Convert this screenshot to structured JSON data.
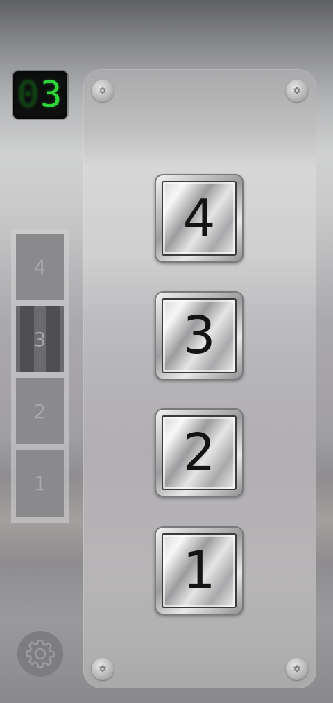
{
  "display": {
    "ghost_digit": "0",
    "current_floor_digit": "3"
  },
  "shaft": {
    "floors": [
      {
        "label": "4"
      },
      {
        "label": "3"
      },
      {
        "label": "2"
      },
      {
        "label": "1"
      }
    ],
    "current_floor": 3
  },
  "panel": {
    "buttons": [
      {
        "label": "4"
      },
      {
        "label": "3"
      },
      {
        "label": "2"
      },
      {
        "label": "1"
      }
    ]
  },
  "icons": {
    "settings": "gear-icon",
    "screw": "screw-icon"
  },
  "colors": {
    "display_digit": "#2fd63a",
    "display_background": "#0d0f0e"
  }
}
